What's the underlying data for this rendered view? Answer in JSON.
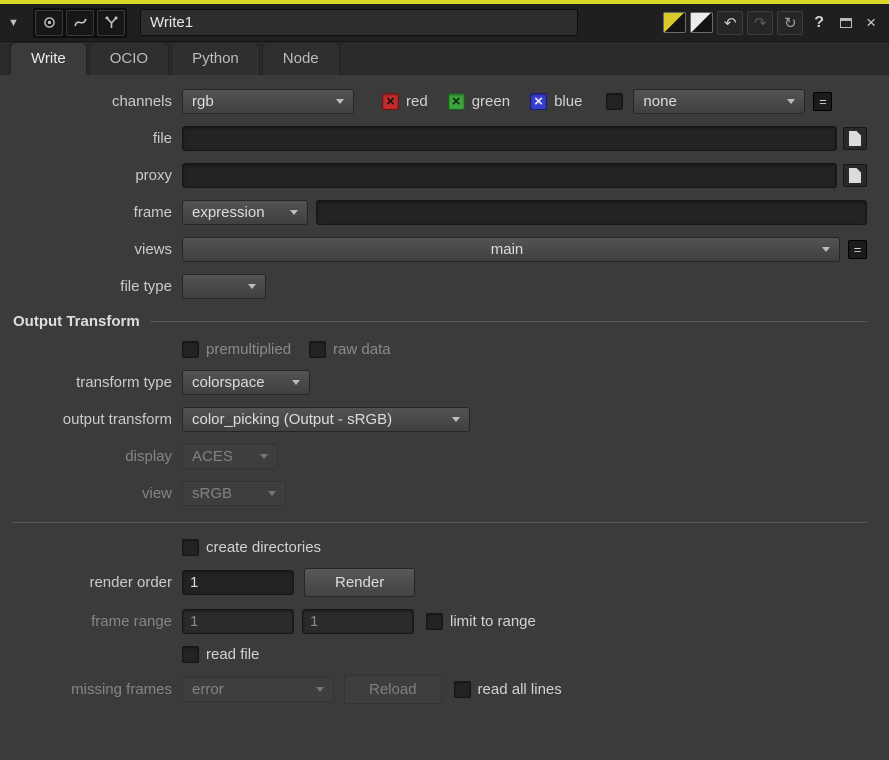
{
  "titlebar": {
    "node_name": "Write1",
    "collapse_icon": "▼",
    "undo_icon": "↶",
    "redo_icon": "↷",
    "revert_icon": "↻",
    "help_label": "?",
    "close_label": "×"
  },
  "tabs": {
    "write": "Write",
    "ocio": "OCIO",
    "python": "Python",
    "node": "Node"
  },
  "channels": {
    "label": "channels",
    "value": "rgb",
    "check_icon": "×",
    "red_label": "red",
    "green_label": "green",
    "blue_label": "blue",
    "mask_value": "none",
    "equals": "="
  },
  "file": {
    "label": "file",
    "value": ""
  },
  "proxy": {
    "label": "proxy",
    "value": ""
  },
  "frame": {
    "label": "frame",
    "mode": "expression",
    "value": ""
  },
  "views": {
    "label": "views",
    "value": "main",
    "equals": "="
  },
  "file_type": {
    "label": "file type",
    "value": ""
  },
  "output_transform_section": {
    "title": "Output Transform"
  },
  "premultiplied": {
    "label": "premultiplied"
  },
  "raw_data": {
    "label": "raw data"
  },
  "transform_type": {
    "label": "transform type",
    "value": "colorspace"
  },
  "output_transform": {
    "label": "output transform",
    "value": "color_picking (Output - sRGB)"
  },
  "display": {
    "label": "display",
    "value": "ACES"
  },
  "view": {
    "label": "view",
    "value": "sRGB"
  },
  "create_directories": {
    "label": "create directories"
  },
  "render_order": {
    "label": "render order",
    "value": "1",
    "render_button": "Render"
  },
  "frame_range": {
    "label": "frame range",
    "first": "1",
    "last": "1",
    "limit_label": "limit to range"
  },
  "read_file": {
    "label": "read file"
  },
  "missing_frames": {
    "label": "missing frames",
    "value": "error",
    "reload_button": "Reload",
    "read_all_lines_label": "read all lines"
  },
  "colors": {
    "accent_top": "#d9da26",
    "channel_red": "#c22c2c",
    "channel_green": "#3da43d",
    "channel_blue": "#3a3ecf"
  }
}
